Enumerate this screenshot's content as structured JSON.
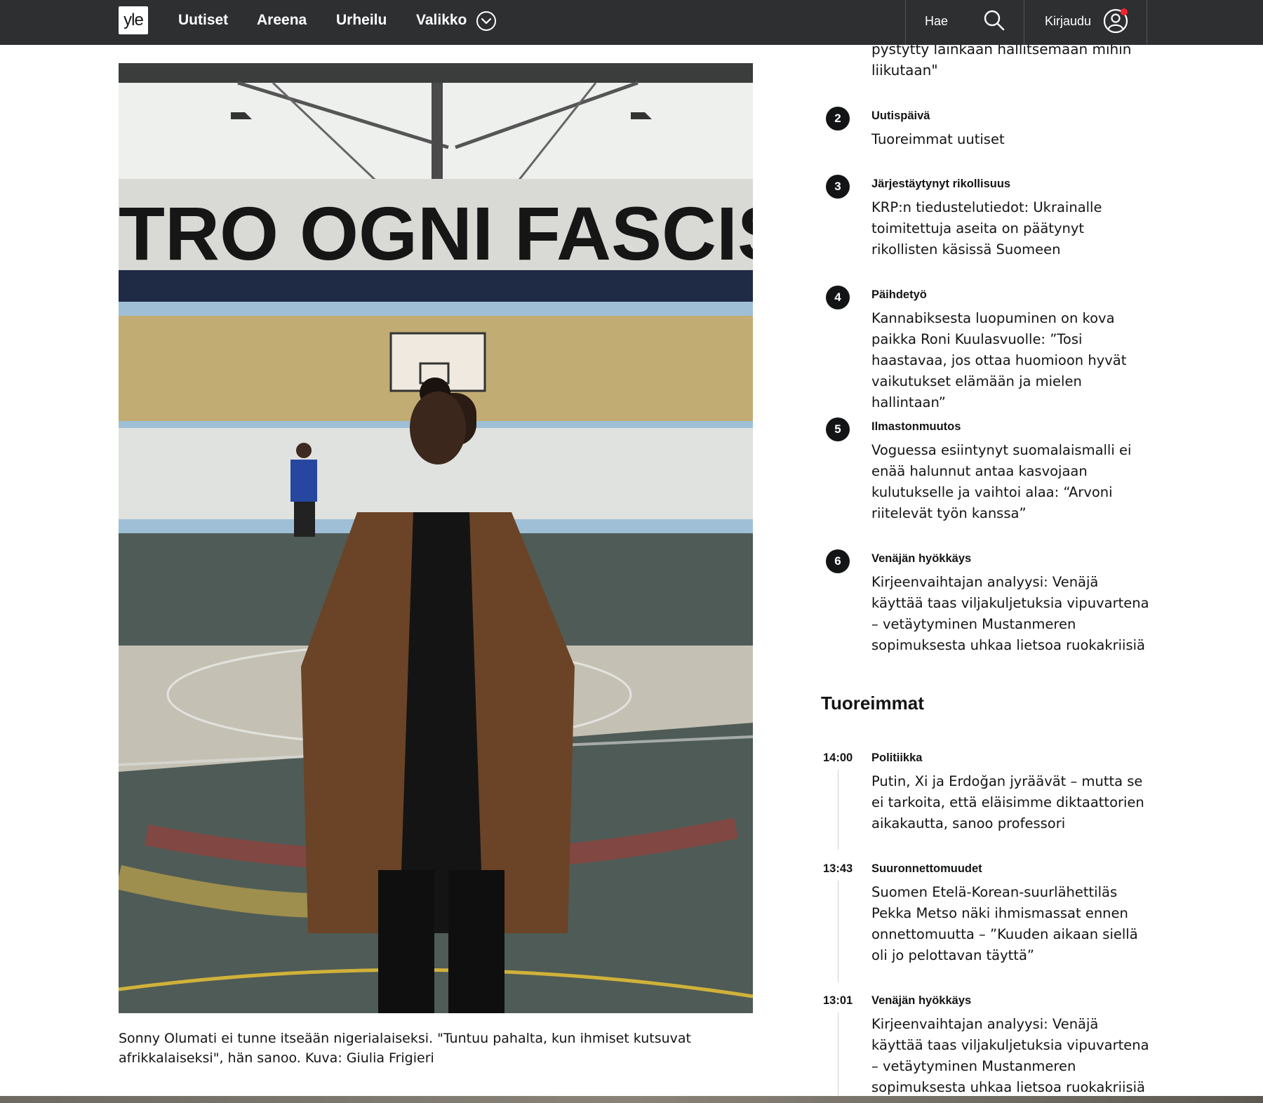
{
  "header": {
    "logo": "yle",
    "nav": [
      "Uutiset",
      "Areena",
      "Urheilu",
      "Valikko"
    ],
    "menu_icon": "chevron-down-circle-icon",
    "search_label": "Hae",
    "search_icon": "search-icon",
    "login_label": "Kirjaudu",
    "user_icon": "user-circle-icon",
    "notification_color": "#f5222d",
    "background_color": "#2d2f31"
  },
  "article": {
    "photo_caption": "Sonny Olumati ei tunne itseään nigerialaiseksi. \"Tuntuu pahalta, kun ihmiset kutsuvat afrikkalaiseksi\", hän sanoo. Kuva: Giulia Frigieri",
    "photo_text": "TRO OGNI FASCISM"
  },
  "most_read": {
    "cut_off_headline": "pystytty lainkaan hallitsemaan mihin liikutaan\"",
    "items": [
      {
        "rank": "2",
        "category": "Uutispäivä",
        "headline": "Tuoreimmat uutiset"
      },
      {
        "rank": "3",
        "category": "Järjestäytynyt rikollisuus",
        "headline": "KRP:n tiedustelutiedot: Ukrainalle toimitettuja aseita on päätynyt rikollisten käsissä Suomeen"
      },
      {
        "rank": "4",
        "category": "Päihdetyö",
        "headline": "Kannabiksesta luopuminen on kova paikka Roni Kuulasvuolle: ”Tosi haastavaa, jos ottaa huomioon hyvät vaikutukset elämään ja mielen hallintaan”"
      },
      {
        "rank": "5",
        "category": "Ilmastonmuutos",
        "headline": "Voguessa esiintynyt suomalaismalli ei enää halunnut antaa kasvojaan kulutukselle ja vaihtoi alaa: “Arvoni riitelevät työn kanssa”"
      },
      {
        "rank": "6",
        "category": "Venäjän hyökkäys",
        "headline": "Kirjeenvaihtajan analyysi: Venäjä käyttää taas viljakuljetuksia vipuvartena – vetäytyminen Mustanmeren sopimuksesta uhkaa lietsoa ruokakriisiä"
      }
    ]
  },
  "latest": {
    "title": "Tuoreimmat",
    "items": [
      {
        "time": "14:00",
        "category": "Politiikka",
        "headline": "Putin, Xi ja Erdoğan jyräävät – mutta se ei tarkoita, että eläisimme diktaattorien aikakautta, sanoo professori"
      },
      {
        "time": "13:43",
        "category": "Suuronnettomuudet",
        "headline": "Suomen Etelä-Korean-suurlähettiläs Pekka Metso näki ihmismassat ennen onnettomuutta – ”Kuuden aikaan siellä oli jo pelottavan täyttä”"
      },
      {
        "time": "13:01",
        "category": "Venäjän hyökkäys",
        "headline": "Kirjeenvaihtajan analyysi: Venäjä käyttää taas viljakuljetuksia vipuvartena – vetäytyminen Mustanmeren sopimuksesta uhkaa lietsoa ruokakriisiä"
      }
    ]
  }
}
